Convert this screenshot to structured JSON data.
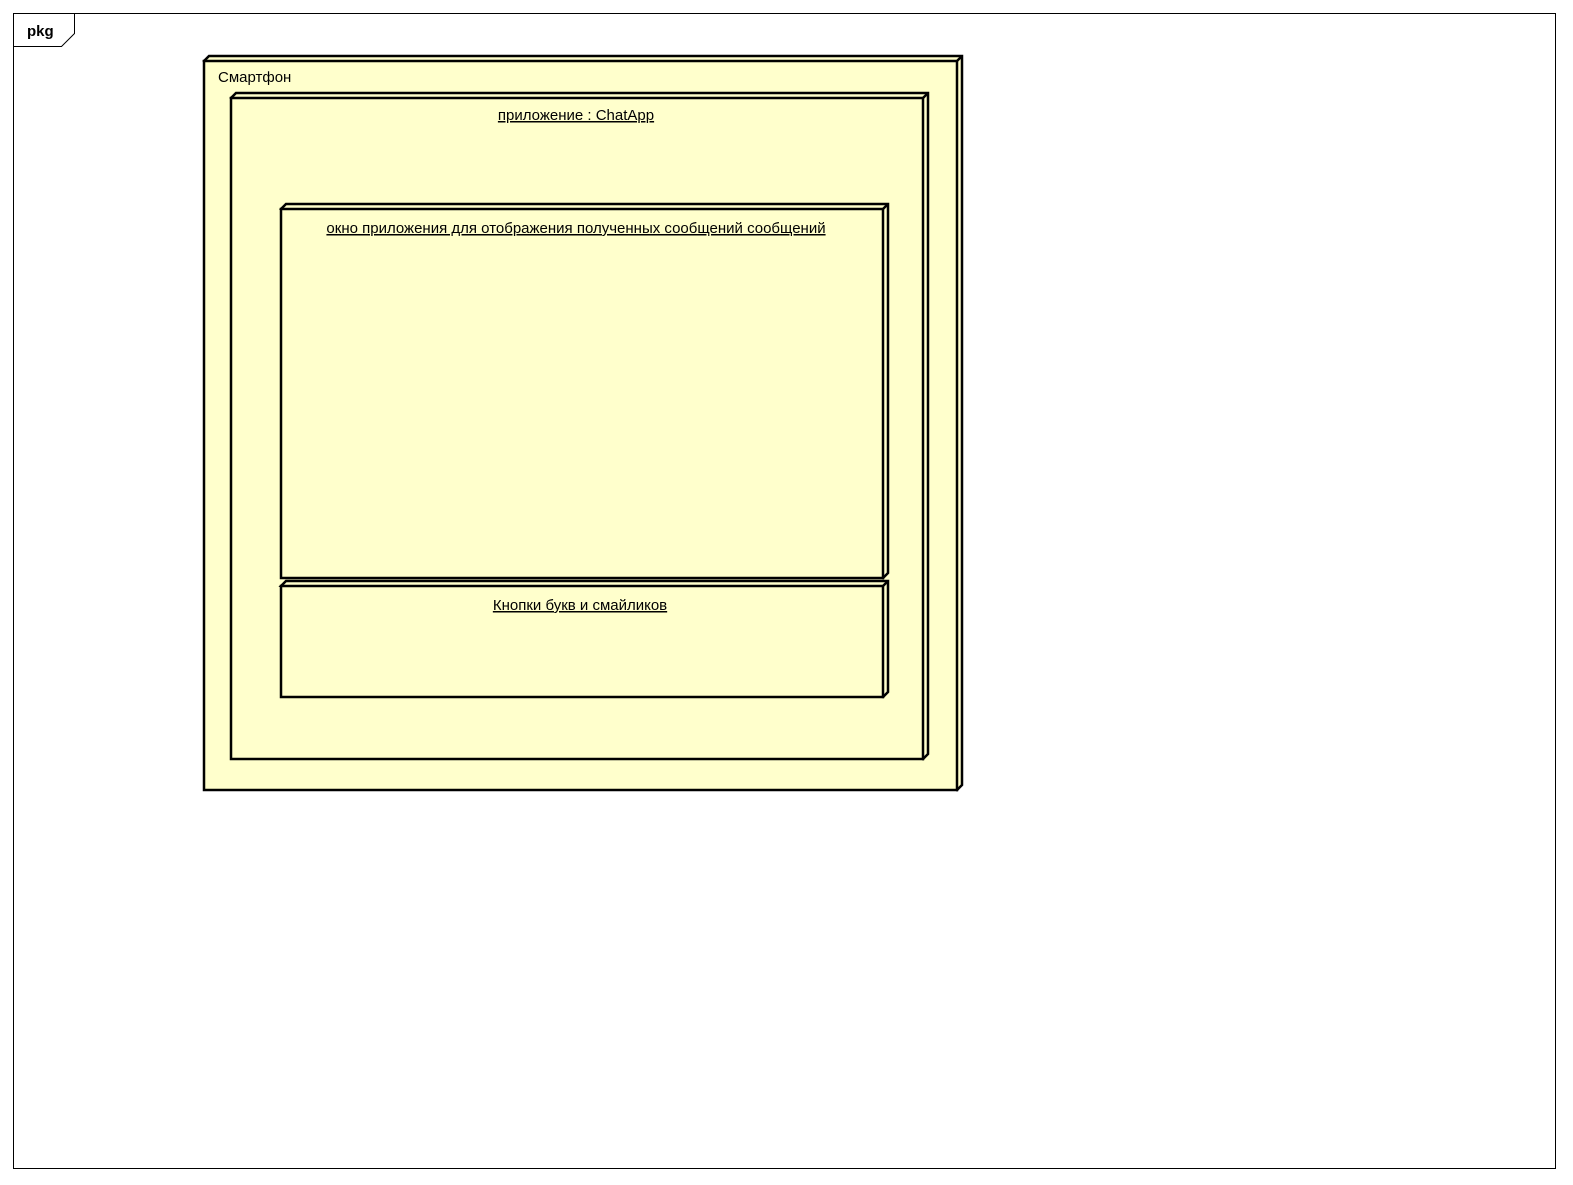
{
  "frame": {
    "tab_label": "pkg"
  },
  "colors": {
    "node_fill": "#ffffcc",
    "node_stroke": "#000000",
    "frame_stroke": "#000000",
    "background": "#ffffff"
  },
  "nodes": {
    "smartphone": {
      "label": "Смартфон"
    },
    "app_instance": {
      "label": "приложение : ChatApp"
    },
    "message_window": {
      "label": "окно приложения для отображения полученных сообщений сообщений"
    },
    "buttons_panel": {
      "label": "Кнопки букв и смайликов"
    }
  }
}
